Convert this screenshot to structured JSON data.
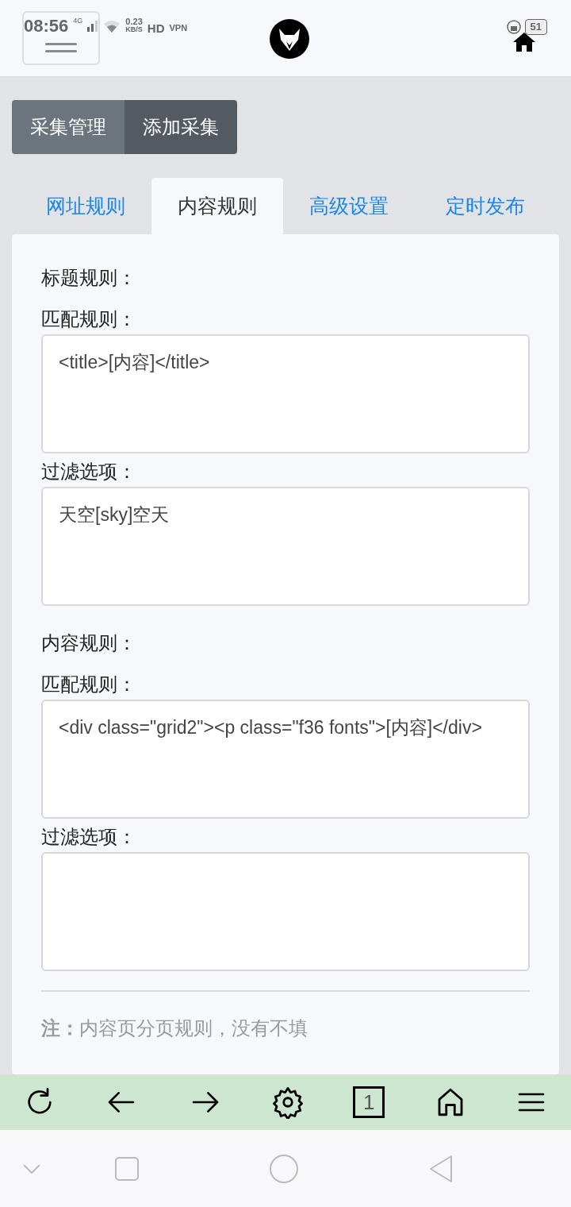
{
  "status_bar": {
    "time": "08:56",
    "network": "4G",
    "speed": "0.23",
    "speed_unit": "KB/S",
    "hd": "HD",
    "vpn": "VPN",
    "battery": "51"
  },
  "top_buttons": [
    {
      "label": "采集管理",
      "selected": false
    },
    {
      "label": "添加采集",
      "selected": true
    }
  ],
  "tabs": [
    {
      "label": "网址规则",
      "selected": false
    },
    {
      "label": "内容规则",
      "selected": true
    },
    {
      "label": "高级设置",
      "selected": false
    },
    {
      "label": "定时发布",
      "selected": false
    }
  ],
  "sections": [
    {
      "heading": "标题规则：",
      "fields": [
        {
          "label": "匹配规则：",
          "value": "<title>[内容]</title>"
        },
        {
          "label": "过滤选项：",
          "value": "天空[sky]空天"
        }
      ]
    },
    {
      "heading": "内容规则：",
      "fields": [
        {
          "label": "匹配规则：",
          "value": "<div class=\"grid2\"><p class=\"f36 fonts\">[内容]</div>"
        },
        {
          "label": "过滤选项："
        }
      ]
    }
  ],
  "note": "**注：**内容页分页规则，没有不填",
  "toolbar": {
    "tab_count": "1"
  }
}
